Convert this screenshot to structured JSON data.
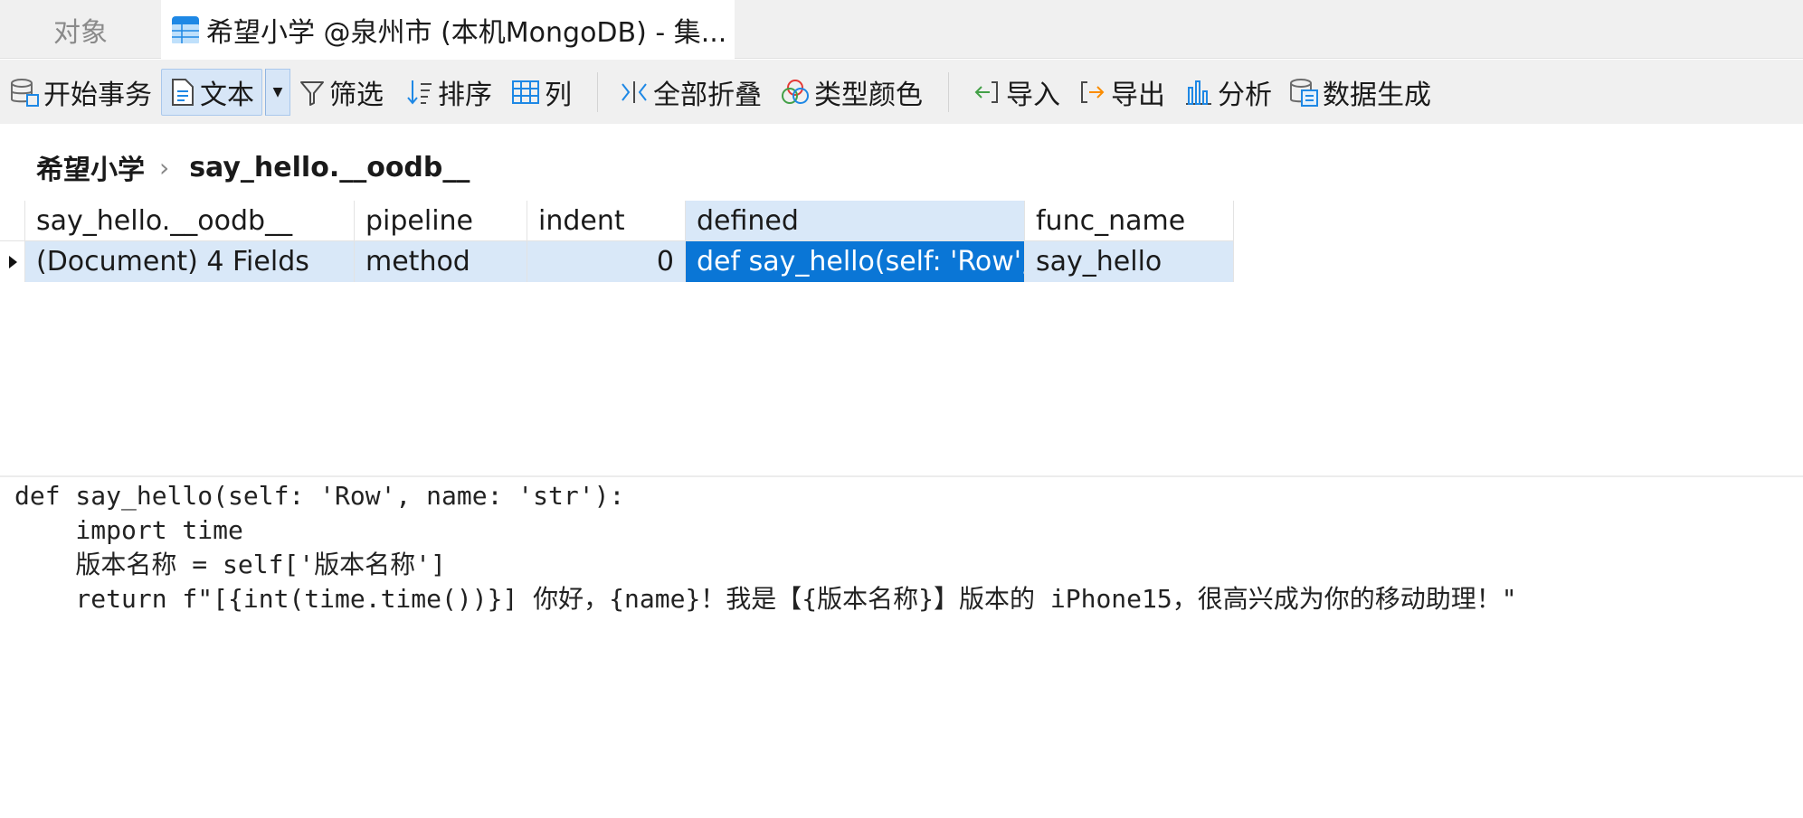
{
  "tabs": {
    "objects_label": "对象",
    "collection_label": "希望小学 @泉州市 (本机MongoDB) - 集..."
  },
  "toolbar": {
    "begin_transaction": "开始事务",
    "text": "文本",
    "filter": "筛选",
    "sort": "排序",
    "columns": "列",
    "collapse_all": "全部折叠",
    "type_colors": "类型颜色",
    "import": "导入",
    "export": "导出",
    "analyze": "分析",
    "data_generation": "数据生成"
  },
  "breadcrumb": {
    "database": "希望小学",
    "collection": "say_hello.__oodb__"
  },
  "grid": {
    "headers": [
      "say_hello.__oodb__",
      "pipeline",
      "indent",
      "defined",
      "func_name"
    ],
    "row": [
      "(Document) 4 Fields",
      "method",
      "0",
      "def say_hello(self: 'Row',",
      "say_hello"
    ]
  },
  "code": {
    "line1": "def say_hello(self: 'Row', name: 'str'):",
    "line2": "    import time",
    "line3": "    版本名称 = self['版本名称']",
    "line4": "    return f\"[{int(time.time())}] 你好，{name}！我是【{版本名称}】版本的 iPhone15，很高兴成为你的移动助理！\""
  },
  "colors": {
    "accent": "#0a76d6",
    "selection": "#d9e8f8",
    "toolbar_bg": "#f0f0f0"
  }
}
